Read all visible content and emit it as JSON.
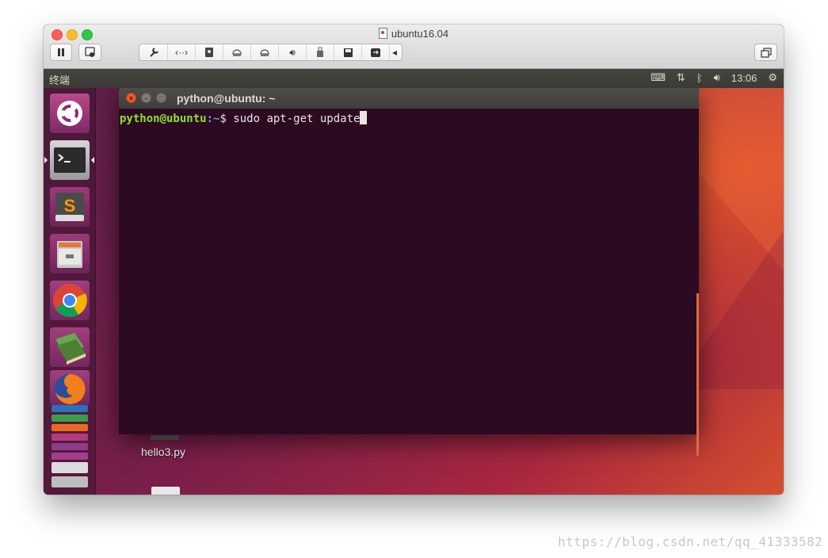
{
  "vm": {
    "title": "ubuntu16.04",
    "toolbar_icons": [
      "pause-icon",
      "snapshot-icon",
      "wrench-icon",
      "code-icon",
      "disk-icon",
      "cd-icon",
      "cd-icon",
      "speaker-icon",
      "usb-icon",
      "save-icon",
      "share-icon",
      "chevron-left-icon",
      "restore-icon"
    ]
  },
  "panel": {
    "title": "终端",
    "time": "13:06"
  },
  "terminal": {
    "title": "python@ubuntu: ~",
    "prompt_user": "python@ubuntu",
    "prompt_path": ":~",
    "prompt_symbol": "$ ",
    "command": "sudo apt-get update"
  },
  "desktop": {
    "file_label": "hello3.py"
  },
  "watermark": "https://blog.csdn.net/qq_41333582",
  "colors": {
    "terminal_bg": "#2c0a22",
    "prompt_user": "#8ae234",
    "prompt_path": "#729fcf",
    "accent": "#e06a3c"
  }
}
